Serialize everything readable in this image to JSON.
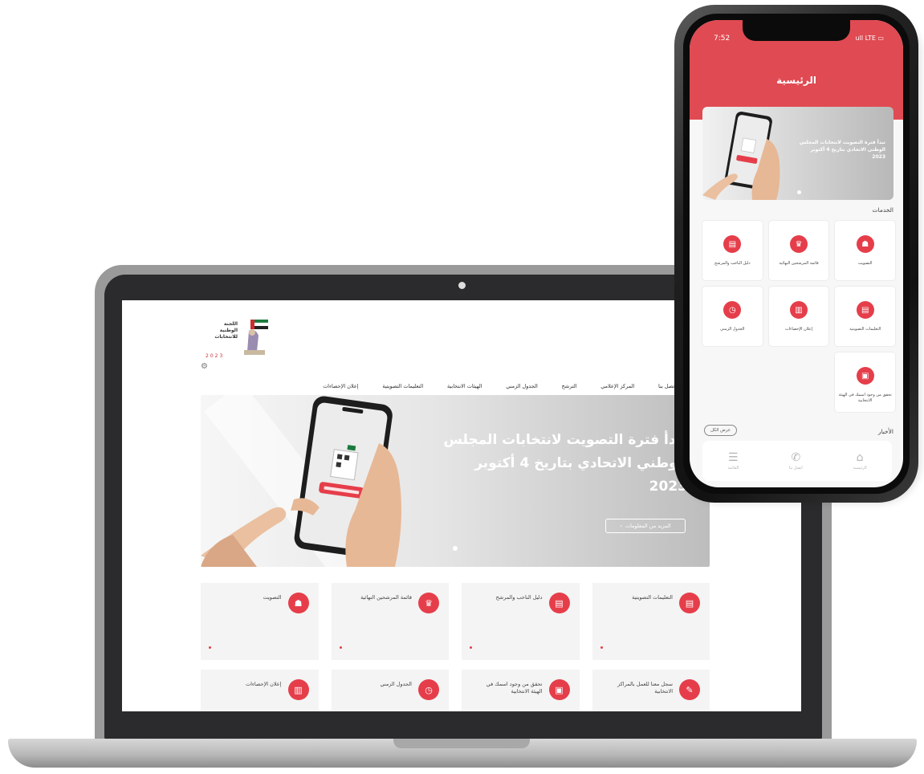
{
  "website": {
    "logo": {
      "text_lines": [
        "اللجنة",
        "الوطنية",
        "للانتخابات"
      ],
      "year": "2023"
    },
    "nav_items": [
      "إعلان الإحصاءات",
      "التعليمات التصويتية",
      "الهيئات الانتخابية",
      "الجدول الزمني",
      "الترشح",
      "المركز الإعلامي",
      "اتصل بنا"
    ],
    "hero": {
      "title_lines": [
        "تبدأ فترة التصويت لانتخابات المجلس",
        "الوطني الاتحادي بتاريخ 4 أكتوبر",
        "2023"
      ],
      "button_label": "المزيد من المعلومات",
      "button_arrow": "‹"
    },
    "cards": [
      {
        "label": "التصويت",
        "icon": "vote-icon",
        "glyph": "☗"
      },
      {
        "label": "قائمة المرشحين النهائية",
        "icon": "trophy-icon",
        "glyph": "♛"
      },
      {
        "label": "دليل الناخب والمرشح",
        "icon": "document-icon",
        "glyph": "▤"
      },
      {
        "label": "التعليمات التصويتية",
        "icon": "document-icon",
        "glyph": "▤"
      },
      {
        "label": "إعلان الإحصاءات",
        "icon": "chart-icon",
        "glyph": "▥"
      },
      {
        "label": "الجدول الزمني",
        "icon": "clock-icon",
        "glyph": "◷"
      },
      {
        "label": "تحقق من وجود اسمك في الهيئة الانتخابية",
        "icon": "id-card-icon",
        "glyph": "▣"
      },
      {
        "label": "سجل معنا للعمل بالمراكز الانتخابية",
        "icon": "register-icon",
        "glyph": "✎"
      }
    ]
  },
  "phone": {
    "status_time": "7:52",
    "status_right": "ull LTE ▭",
    "header_title": "الرئيسية",
    "banner_text": "تبدأ فترة التصويت لانتخابات المجلس الوطني الاتحادي بتاريخ 4 أكتوبر 2023",
    "services_heading": "الخدمات",
    "tiles": [
      {
        "label": "التصويت",
        "icon": "vote-icon",
        "glyph": "☗"
      },
      {
        "label": "قائمة المرشحين النهائية",
        "icon": "trophy-icon",
        "glyph": "♛"
      },
      {
        "label": "دليل الناخب والمرشح",
        "icon": "document-icon",
        "glyph": "▤"
      },
      {
        "label": "التعليمات التصويتية",
        "icon": "document-icon",
        "glyph": "▤"
      },
      {
        "label": "إعلان الإحصاءات",
        "icon": "chart-icon",
        "glyph": "▥"
      },
      {
        "label": "الجدول الزمني",
        "icon": "clock-icon",
        "glyph": "◷"
      },
      {
        "label": "تحقق من وجود اسمك في الهيئة الانتخابية",
        "icon": "id-card-icon",
        "glyph": "▣"
      }
    ],
    "news_heading": "الأخبار",
    "view_all_label": "عرض الكل",
    "tabbar": [
      {
        "label": "الرئيسية",
        "icon": "home-icon",
        "glyph": "⌂"
      },
      {
        "label": "اتصل بنا",
        "icon": "phone-icon",
        "glyph": "✆"
      },
      {
        "label": "القائمة",
        "icon": "menu-icon",
        "glyph": "☰"
      }
    ]
  },
  "colors": {
    "brand_red": "#e04a52",
    "icon_red": "#e53e4a",
    "card_bg": "#f4f4f4"
  }
}
